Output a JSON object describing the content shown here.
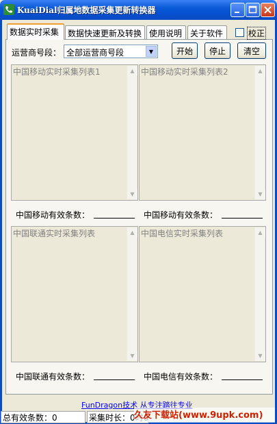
{
  "window": {
    "title": "KuaiDial归属地数据采集更新转换器"
  },
  "tabs": [
    {
      "label": "数据实时采集",
      "active": true
    },
    {
      "label": "数据快速更新及转换",
      "active": false
    },
    {
      "label": "使用说明",
      "active": false
    },
    {
      "label": "关于软件",
      "active": false
    }
  ],
  "correction_checkbox": {
    "label": "校正",
    "checked": false
  },
  "carrier": {
    "label": "运营商号段：",
    "selected": "全部运营商号段"
  },
  "buttons": {
    "start": "开始",
    "stop": "停止",
    "clear": "清空"
  },
  "lists": {
    "mobile": {
      "title": "中国移动实时采集列表1",
      "count_label": "中国移动有效条数："
    },
    "mobile2": {
      "title": "中国移动实时采集列表2",
      "count_label": "中国移动有效条数："
    },
    "unicom": {
      "title": "中国联通实时采集列表",
      "count_label": "中国联通有效条数："
    },
    "telecom": {
      "title": "中国电信实时采集列表",
      "count_label": "中国电信有效条数："
    }
  },
  "footer": {
    "link_text": "FunDragon技术  从专注踏往专业"
  },
  "status": {
    "total_label": "总有效条数：0",
    "time_label": "采集时长：0时0分"
  },
  "watermark": "久友下载站(www.9upk.com)",
  "colors": {
    "titlebar": "#0a5ad8",
    "window_bg": "#ece9d8",
    "tab_accent": "#f0a030"
  }
}
